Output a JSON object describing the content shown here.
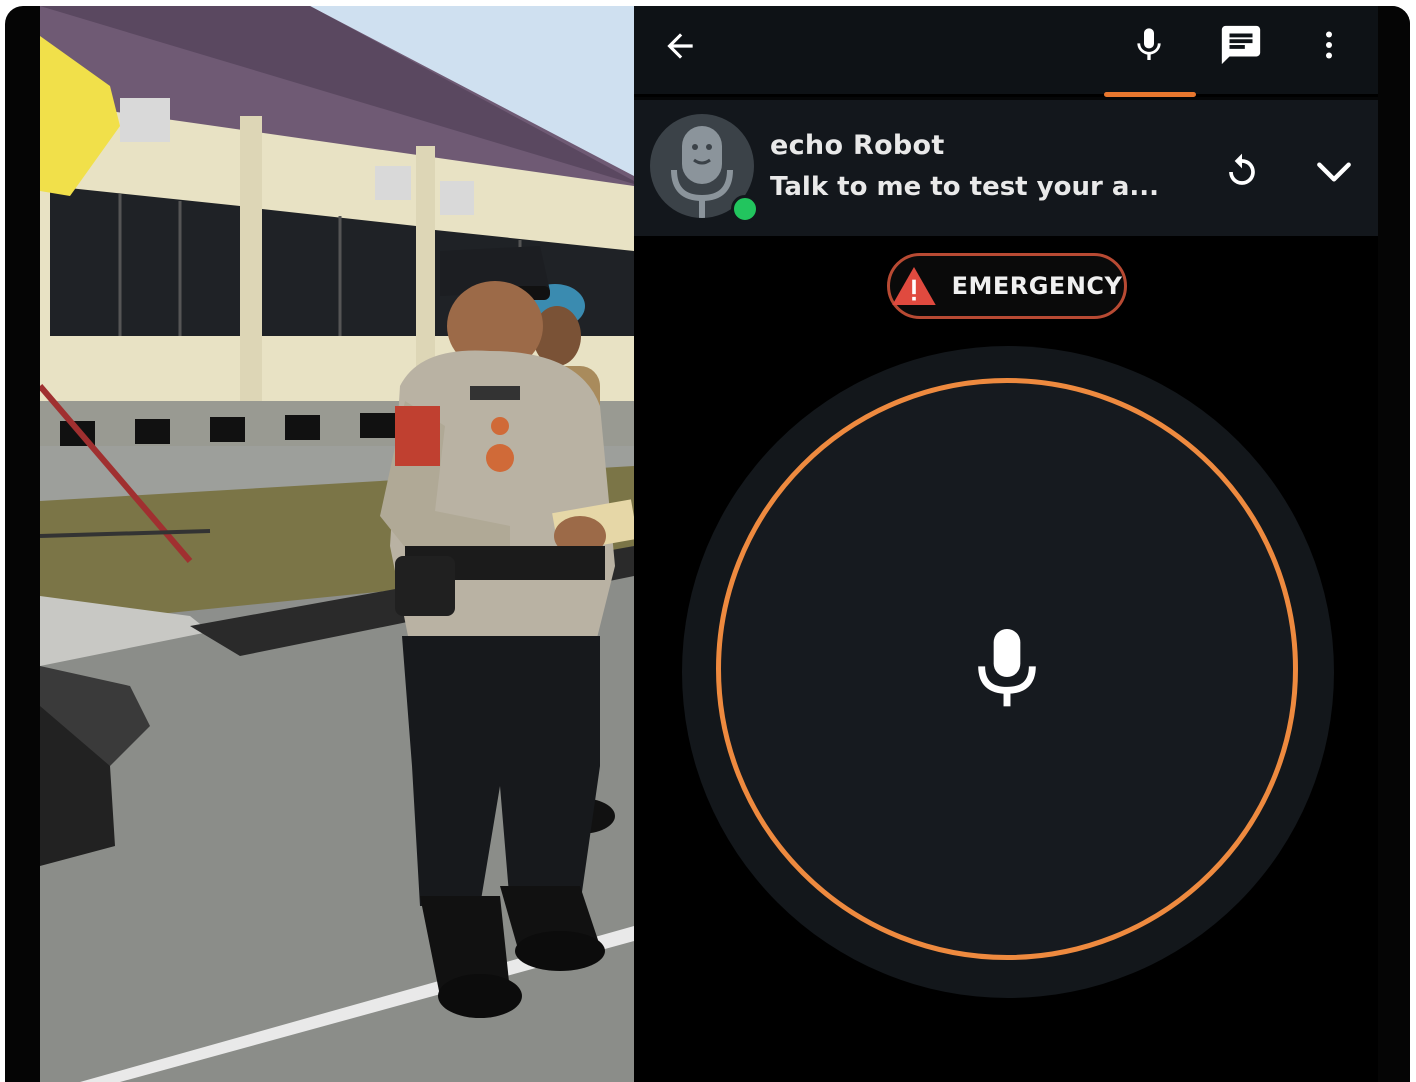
{
  "photo": {
    "description_icon": "photo-icon"
  },
  "toolbar": {
    "back_icon": "arrow-left-icon",
    "mic_tab_icon": "microphone-icon",
    "chat_tab_icon": "chat-icon",
    "more_icon": "more-vertical-icon",
    "active_tab": "microphone",
    "accent_color": "#e8772e"
  },
  "bot": {
    "name": "echo Robot",
    "subtitle": "Talk to me to test your a...",
    "status": "online",
    "status_color": "#22c55e",
    "refresh_icon": "refresh-icon",
    "collapse_icon": "chevron-down-icon"
  },
  "emergency": {
    "label": "EMERGENCY",
    "icon": "warning-icon",
    "color": "#e04a3f"
  },
  "voice": {
    "icon": "microphone-icon",
    "ring_color": "#ee8a3f"
  }
}
